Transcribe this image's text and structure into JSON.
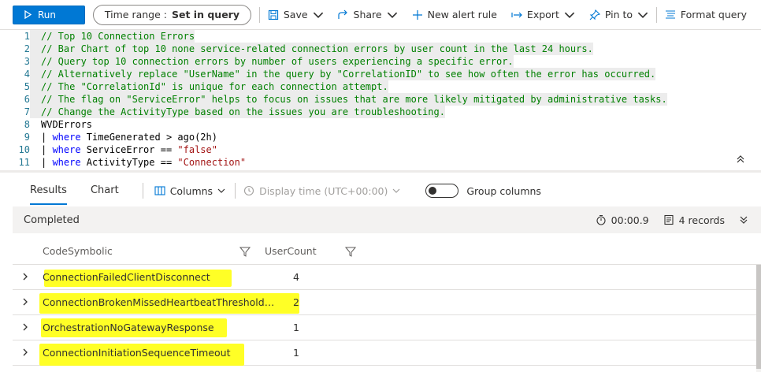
{
  "toolbar": {
    "run_label": "Run",
    "time_range_label": "Time range :",
    "time_range_value": "Set in query",
    "save_label": "Save",
    "share_label": "Share",
    "new_alert_label": "New alert rule",
    "export_label": "Export",
    "pin_label": "Pin to",
    "format_label": "Format query"
  },
  "editor": {
    "lines": [
      {
        "n": "1",
        "text": "// Top 10 Connection Errors"
      },
      {
        "n": "2",
        "text": "// Bar Chart of top 10 none service-related connection errors by user count in the last 24 hours."
      },
      {
        "n": "3",
        "text": "// Query top 10 connection errors by number of users experiencing a specific error."
      },
      {
        "n": "4",
        "text": "// Alternatively replace \"UserName\" in the query by \"CorrelationID\" to see how often the error has occurred."
      },
      {
        "n": "5",
        "text": "// The \"CorrelationId\" is unique for each connection attempt."
      },
      {
        "n": "6",
        "text": "// The flag on \"ServiceError\" helps to focus on issues that are more likely mitigated by administrative tasks."
      },
      {
        "n": "7",
        "text": "// Change the ActivityType based on the issues you are troubleshooting."
      },
      {
        "n": "8",
        "text": "WVDErrors"
      },
      {
        "n": "9",
        "pipe": "| ",
        "kw": "where",
        "plain": " TimeGenerated > ago(2h)",
        "str": ""
      },
      {
        "n": "10",
        "pipe": "| ",
        "kw": "where",
        "plain": " ServiceError == ",
        "str": "\"false\""
      },
      {
        "n": "11",
        "pipe": "| ",
        "kw": "where",
        "plain": " ActivityType == ",
        "str": "\"Connection\""
      }
    ]
  },
  "tabs": {
    "results_label": "Results",
    "chart_label": "Chart",
    "columns_label": "Columns",
    "display_time_label": "Display time (UTC+00:00)",
    "group_columns_label": "Group columns"
  },
  "status": {
    "state": "Completed",
    "duration": "00:00.9",
    "records": "4 records"
  },
  "table": {
    "columns": [
      "CodeSymbolic",
      "UserCount"
    ],
    "rows": [
      {
        "code": "ConnectionFailedClientDisconnect",
        "count": "4"
      },
      {
        "code": "ConnectionBrokenMissedHeartbeatThresholdExc...",
        "count": "2"
      },
      {
        "code": "OrchestrationNoGatewayResponse",
        "count": "1"
      },
      {
        "code": "ConnectionInitiationSequenceTimeout",
        "count": "1"
      }
    ]
  },
  "colors": {
    "accent": "#0078d4",
    "highlight": "#ffff00",
    "comment": "#008000",
    "keyword": "#0000ff",
    "string": "#a31515"
  }
}
